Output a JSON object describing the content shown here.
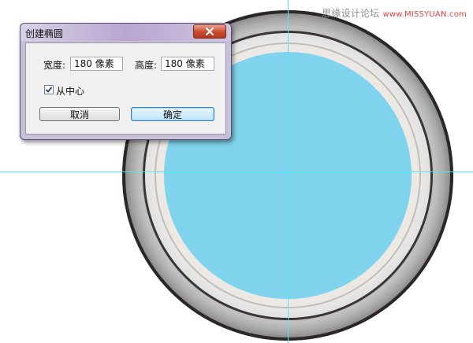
{
  "watermark": {
    "text": "思缘设计论坛",
    "url": "www.MISSYUAN.com"
  },
  "dialog": {
    "title": "创建椭圆",
    "close_icon": "close-icon",
    "width_label": "宽度:",
    "width_value": "180 像素",
    "height_label": "高度:",
    "height_value": "180 像素",
    "from_center_label": "从中心",
    "from_center_checked": true,
    "cancel_label": "取消",
    "ok_label": "确定"
  },
  "colors": {
    "fill": "#7fd3ed",
    "guide": "#4fe8ef",
    "dialog_accent": "#b7a6d0"
  }
}
